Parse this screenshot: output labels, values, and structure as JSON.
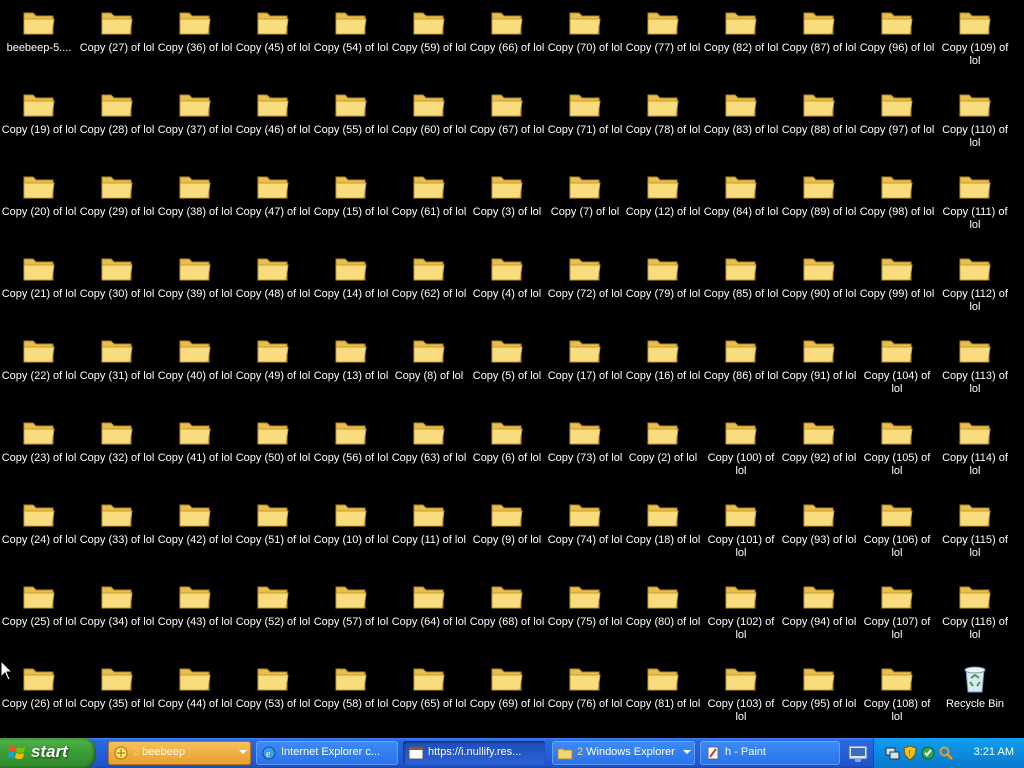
{
  "desktop": {
    "columns": [
      [
        "beebeep-5....",
        "Copy (19) of lol",
        "Copy (20) of lol",
        "Copy (21) of lol",
        "Copy (22) of lol",
        "Copy (23) of lol",
        "Copy (24) of lol",
        "Copy (25) of lol",
        "Copy (26) of lol"
      ],
      [
        "Copy (27) of lol",
        "Copy (28) of lol",
        "Copy (29) of lol",
        "Copy (30) of lol",
        "Copy (31) of lol",
        "Copy (32) of lol",
        "Copy (33) of lol",
        "Copy (34) of lol",
        "Copy (35) of lol"
      ],
      [
        "Copy (36) of lol",
        "Copy (37) of lol",
        "Copy (38) of lol",
        "Copy (39) of lol",
        "Copy (40) of lol",
        "Copy (41) of lol",
        "Copy (42) of lol",
        "Copy (43) of lol",
        "Copy (44) of lol"
      ],
      [
        "Copy (45) of lol",
        "Copy (46) of lol",
        "Copy (47) of lol",
        "Copy (48) of lol",
        "Copy (49) of lol",
        "Copy (50) of lol",
        "Copy (51) of lol",
        "Copy (52) of lol",
        "Copy (53) of lol"
      ],
      [
        "Copy (54) of lol",
        "Copy (55) of lol",
        "Copy (15) of lol",
        "Copy (14) of lol",
        "Copy (13) of lol",
        "Copy (56) of lol",
        "Copy (10) of lol",
        "Copy (57) of lol",
        "Copy (58) of lol"
      ],
      [
        "Copy (59) of lol",
        "Copy (60) of lol",
        "Copy (61) of lol",
        "Copy (62) of lol",
        "Copy (8) of lol",
        "Copy (63) of lol",
        "Copy (11) of lol",
        "Copy (64) of lol",
        "Copy (65) of lol"
      ],
      [
        "Copy (66) of lol",
        "Copy (67) of lol",
        "Copy (3) of lol",
        "Copy (4) of lol",
        "Copy (5) of lol",
        "Copy (6) of lol",
        "Copy (9) of lol",
        "Copy (68) of lol",
        "Copy (69) of lol"
      ],
      [
        "Copy (70) of lol",
        "Copy (71) of lol",
        "Copy (7) of lol",
        "Copy (72) of lol",
        "Copy (17) of lol",
        "Copy (73) of lol",
        "Copy (74) of lol",
        "Copy (75) of lol",
        "Copy (76) of lol"
      ],
      [
        "Copy (77) of lol",
        "Copy (78) of lol",
        "Copy (12) of lol",
        "Copy (79) of lol",
        "Copy (16) of lol",
        "Copy (2) of lol",
        "Copy (18) of lol",
        "Copy (80) of lol",
        "Copy (81) of lol"
      ],
      [
        "Copy (82) of lol",
        "Copy (83) of lol",
        "Copy (84) of lol",
        "Copy (85) of lol",
        "Copy (86) of lol",
        "Copy (100) of lol",
        "Copy (101) of lol",
        "Copy (102) of lol",
        "Copy (103) of lol"
      ],
      [
        "Copy (87) of lol",
        "Copy (88) of lol",
        "Copy (89) of lol",
        "Copy (90) of lol",
        "Copy (91) of lol",
        "Copy (92) of lol",
        "Copy (93) of lol",
        "Copy (94) of lol",
        "Copy (95) of lol"
      ],
      [
        "Copy (96) of lol",
        "Copy (97) of lol",
        "Copy (98) of lol",
        "Copy (99) of lol",
        "Copy (104) of lol",
        "Copy (105) of lol",
        "Copy (106) of lol",
        "Copy (107) of lol",
        "Copy (108) of lol"
      ],
      [
        "Copy (109) of lol",
        "Copy (110) of lol",
        "Copy (111) of lol",
        "Copy (112) of lol",
        "Copy (113) of lol",
        "Copy (114) of lol",
        "Copy (115) of lol",
        "Copy (116) of lol",
        "Recycle Bin"
      ]
    ],
    "icon_type": "folder-icon",
    "recycle_bin_icon": "recycle-bin-icon"
  },
  "taskbar": {
    "start_label": "start",
    "tasks": [
      {
        "count": "2",
        "label": "beebeep",
        "icon": "beebeep-icon",
        "state": "active",
        "dropdown": true
      },
      {
        "count": "",
        "label": "Internet Explorer c...",
        "icon": "internet-explorer-icon",
        "state": "normal",
        "dropdown": false
      },
      {
        "count": "",
        "label": "https://i.nullify.res...",
        "icon": "browser-window-icon",
        "state": "pressed",
        "dropdown": false
      },
      {
        "count": "2",
        "label": "Windows Explorer",
        "icon": "folder-icon",
        "state": "normal",
        "dropdown": true
      },
      {
        "count": "",
        "label": "h - Paint",
        "icon": "paint-icon",
        "state": "normal",
        "dropdown": false
      }
    ],
    "tray_icons": [
      "network-icon",
      "security-shield-icon",
      "antivirus-icon",
      "search-icon"
    ],
    "clock": "3:21 AM"
  },
  "colors": {
    "desktop_background": "#000000",
    "folder": "#f4d675",
    "taskbar": "#245edb",
    "start_button": "#3c9b36",
    "tray": "#0c8bdf",
    "active_task": "#e89d2d"
  }
}
